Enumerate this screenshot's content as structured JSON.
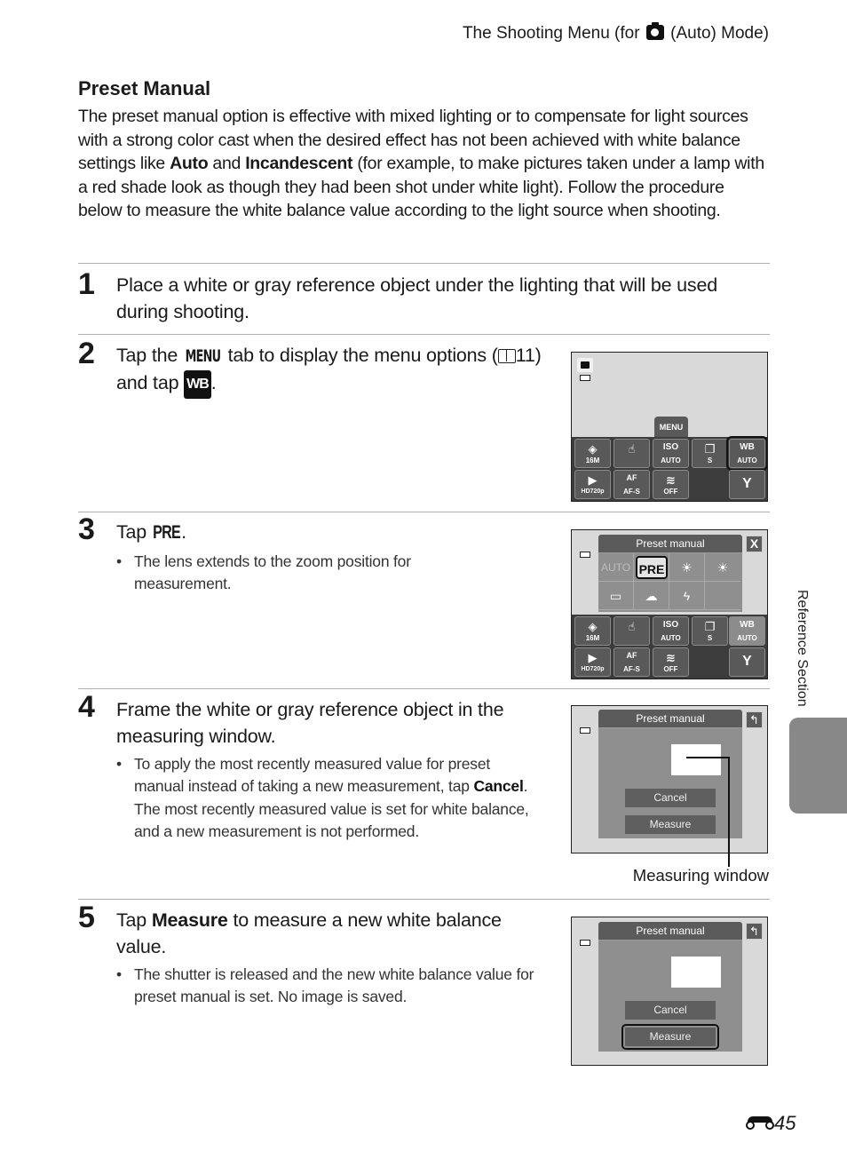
{
  "header": {
    "title_before": "The Shooting Menu (for",
    "title_icon": "auto-mode-camera-icon",
    "title_after": "(Auto) Mode)"
  },
  "section": {
    "title": "Preset Manual",
    "intro": {
      "part1": "The preset manual option is effective with mixed lighting or to compensate for light sources with a strong color cast when the desired effect has not been achieved with white balance settings like ",
      "bold1": "Auto",
      "part2": " and ",
      "bold2": "Incandescent",
      "part3": " (for example, to make pictures taken under a lamp with a red shade look as though they had been shot under white light). Follow the procedure below to measure the white balance value according to the light source when shooting."
    }
  },
  "steps": [
    {
      "number": "1",
      "text": "Place a white or gray reference object under the lighting that will be used during shooting."
    },
    {
      "number": "2",
      "text_a": "Tap the ",
      "menu_glyph": "MENU",
      "text_b": " tab to display the menu options (",
      "ref_page": "11",
      "text_c": ") and tap ",
      "wb_glyph": "WB",
      "text_d": "."
    },
    {
      "number": "3",
      "text_a": "Tap ",
      "pre_glyph": "PRE",
      "text_b": ".",
      "bullets": [
        "The lens extends to the zoom position for measurement."
      ]
    },
    {
      "number": "4",
      "text": "Frame the white or gray reference object in the measuring window.",
      "bullet_a": "To apply the most recently measured value for preset manual instead of taking a new measurement, tap ",
      "bullet_bold": "Cancel",
      "bullet_b": ". The most recently measured value is set for white balance, and a new measurement is not performed."
    },
    {
      "number": "5",
      "text_a": "Tap ",
      "text_bold": "Measure",
      "text_b": " to measure a new white balance value.",
      "bullets": [
        "The shutter is released and the new white balance value for preset manual is set. No image is saved."
      ]
    }
  ],
  "screens": {
    "menu_tab_label": "MENU",
    "tiles_row1": [
      {
        "icon": "image-mode-icon",
        "glyph": "◈",
        "label": "16M"
      },
      {
        "icon": "touch-shooting-icon",
        "glyph": "☝",
        "label": ""
      },
      {
        "icon": "iso-icon",
        "glyph": "ISO",
        "label": "AUTO"
      },
      {
        "icon": "continuous-icon",
        "glyph": "❐",
        "label": "S"
      },
      {
        "icon": "white-balance-icon",
        "glyph": "WB",
        "label": "AUTO"
      }
    ],
    "tiles_row2": [
      {
        "icon": "movie-icon",
        "glyph": "🎥",
        "label": "HD720p"
      },
      {
        "icon": "movie-af-icon",
        "glyph": "AF",
        "label": "AF-S"
      },
      {
        "icon": "wind-noise-icon",
        "glyph": "≋",
        "label": "OFF"
      },
      {
        "icon": "setup-wrench-icon",
        "glyph": "🔧",
        "label": ""
      }
    ],
    "wb_panel_title": "Preset manual",
    "close_label": "X",
    "wb_options_row1": [
      "AUTO",
      "PRE",
      "☀",
      "☀"
    ],
    "wb_options_row2": [
      "▭",
      "☁",
      "ϟ",
      ""
    ],
    "preset_title": "Preset manual",
    "cancel_label": "Cancel",
    "measure_label": "Measure",
    "back_icon": "↰"
  },
  "callout": "Measuring window",
  "side_tab_label": "Reference Section",
  "page_number": "45"
}
